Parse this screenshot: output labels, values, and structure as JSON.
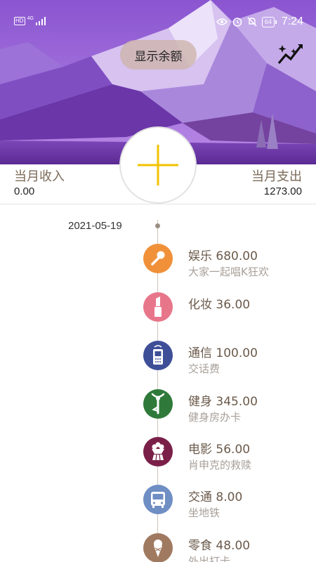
{
  "status": {
    "network_badge": "HD",
    "network_type": "4G",
    "battery": "64",
    "time": "7:24"
  },
  "header": {
    "balance_button": "显示余额",
    "chart_icon": "trend-chart-icon"
  },
  "summary": {
    "income_label": "当月收入",
    "income_value": "0.00",
    "expense_label": "当月支出",
    "expense_value": "1273.00"
  },
  "timeline": {
    "date": "2021-05-19",
    "entries": [
      {
        "category": "娱乐",
        "amount": "680.00",
        "note": "大家一起唱K狂欢",
        "icon": "microphone-icon",
        "color": "#f0913a"
      },
      {
        "category": "化妆",
        "amount": "36.00",
        "note": "",
        "icon": "lipstick-icon",
        "color": "#e8768a"
      },
      {
        "category": "通信",
        "amount": "100.00",
        "note": "交话费",
        "icon": "mobile-phone-icon",
        "color": "#3e4f98"
      },
      {
        "category": "健身",
        "amount": "345.00",
        "note": "健身房办卡",
        "icon": "yoga-icon",
        "color": "#2f7a3a"
      },
      {
        "category": "电影",
        "amount": "56.00",
        "note": "肖申克的救赎",
        "icon": "popcorn-icon",
        "color": "#7a2048"
      },
      {
        "category": "交通",
        "amount": "8.00",
        "note": "坐地铁",
        "icon": "bus-icon",
        "color": "#6f8ec4"
      },
      {
        "category": "零食",
        "amount": "48.00",
        "note": "外出打卡",
        "icon": "ice-cream-icon",
        "color": "#a07a60"
      }
    ]
  },
  "colors": {
    "accent_plus": "#f2c200",
    "label_brown": "#7b6a58"
  }
}
